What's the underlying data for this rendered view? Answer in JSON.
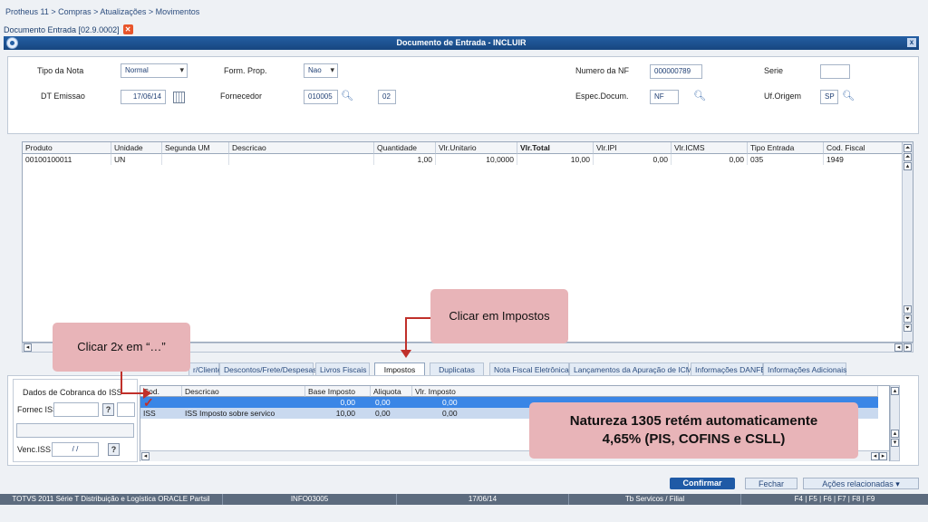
{
  "breadcrumb": "Protheus 11 > Compras  > Atualizações > Movimentos",
  "doc_tab": {
    "label": "Documento Entrada [02.9.0002]",
    "close_icon": "close-icon"
  },
  "window": {
    "title": "Documento de Entrada - INCLUIR",
    "close": "x"
  },
  "header": {
    "tipo_nota": {
      "label": "Tipo da Nota",
      "value": "Normal"
    },
    "form_prop": {
      "label": "Form. Prop.",
      "value": "Nao"
    },
    "numero_nf": {
      "label": "Numero da NF",
      "value": "000000789"
    },
    "serie": {
      "label": "Serie",
      "value": ""
    },
    "dt_emissao": {
      "label": "DT Emissao",
      "value": "17/06/14"
    },
    "fornecedor": {
      "label": "Fornecedor",
      "value": "010005",
      "loja": "02"
    },
    "espec_docum": {
      "label": "Espec.Docum.",
      "value": "NF"
    },
    "uf_origem": {
      "label": "Uf.Origem",
      "value": "SP"
    }
  },
  "items_grid": {
    "columns": [
      "Produto",
      "Unidade",
      "Segunda UM",
      "Descricao",
      "Quantidade",
      "Vlr.Unitario",
      "Vlr.Total",
      "Vlr.IPI",
      "Vlr.ICMS",
      "Tipo Entrada",
      "Cod. Fiscal"
    ],
    "rows": [
      [
        "00100100011",
        "UN",
        "",
        "",
        "1,00",
        "10,0000",
        "10,00",
        "0,00",
        "0,00",
        "035",
        "1949"
      ]
    ]
  },
  "tabs": [
    "r/Cliente",
    "Descontos/Frete/Despesas",
    "Livros Fiscais",
    "Impostos",
    "Duplicatas",
    "Nota Fiscal Eletrônica",
    "Lançamentos da Apuração de ICMS",
    "Informações DANFE",
    "Informações Adicionais"
  ],
  "cobranca": {
    "title": "Dados de Cobranca do ISS",
    "fornec_label": "Fornec ISS",
    "venc_label": "Venc.ISS",
    "venc_value": " / /",
    "lookup": "?"
  },
  "impostos_grid": {
    "columns": [
      "Cod.",
      "Descricao",
      "Base Imposto",
      "Aliquota",
      "Vlr. Imposto"
    ],
    "rows": [
      [
        "",
        "",
        "0,00",
        "0,00",
        "0,00"
      ],
      [
        "ISS",
        "ISS Imposto sobre servico",
        "10,00",
        "0,00",
        "0,00"
      ]
    ]
  },
  "callouts": {
    "impostos": "Clicar em Impostos",
    "dots": "Clicar 2x em “…”",
    "natureza_line1": "Natureza 1305 retém automaticamente",
    "natureza_line2": "4,65% (PIS, COFINS e CSLL)"
  },
  "actions": {
    "confirmar": "Confirmar",
    "fechar": "Fechar",
    "acoes": "Ações relacionadas"
  },
  "footer": [
    "TOTVS 2011 Série T Distribuição e Logística ORACLE Partsil",
    "INFO03005",
    "17/06/14",
    "Tb Servicos / Filial",
    "F4 | F5 | F6 | F7 | F8 | F9"
  ],
  "colors": {
    "title_bar": "#245fa4",
    "callout": "#e8b4b8",
    "arrow": "#c0302a",
    "selected_row": "#3a86e6"
  }
}
